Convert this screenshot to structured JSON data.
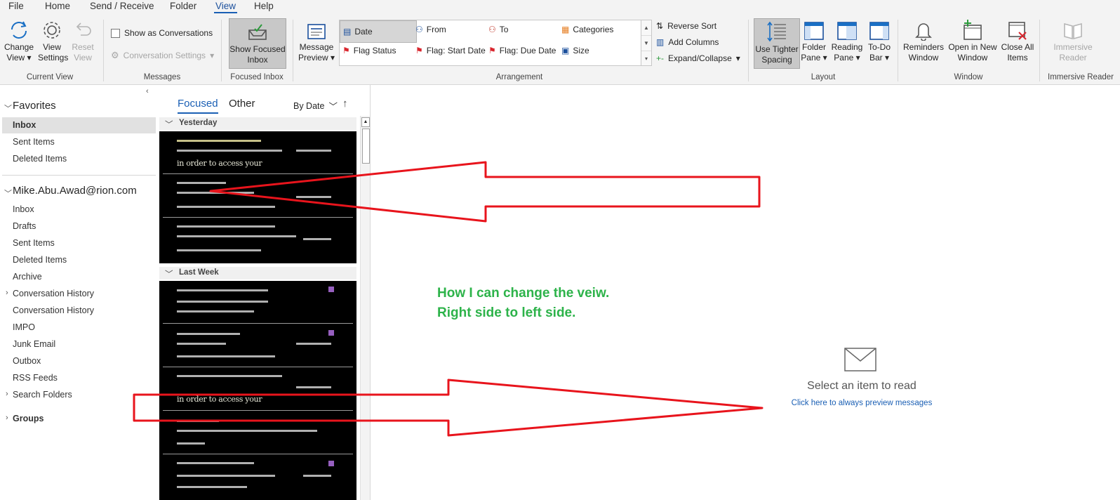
{
  "menu": {
    "tabs": [
      "File",
      "Home",
      "Send / Receive",
      "Folder",
      "View",
      "Help"
    ],
    "active_tab": "View"
  },
  "ribbon": {
    "current_view": {
      "change_view": "Change View",
      "view_settings": "View Settings",
      "reset_view": "Reset View",
      "group_label": "Current View"
    },
    "messages": {
      "show_as_conversations": "Show as Conversations",
      "conversation_settings": "Conversation Settings",
      "group_label": "Messages"
    },
    "focused_inbox": {
      "show_focused_inbox": "Show Focused Inbox",
      "group_label": "Focused Inbox"
    },
    "arrangement": {
      "message_preview": "Message Preview",
      "options": [
        "Date",
        "From",
        "To",
        "Categories",
        "Flag Status",
        "Flag: Start Date",
        "Flag: Due Date",
        "Size"
      ],
      "selected": "Date",
      "reverse_sort": "Reverse Sort",
      "add_columns": "Add Columns",
      "expand_collapse": "Expand/Collapse",
      "group_label": "Arrangement"
    },
    "layout": {
      "use_tighter_spacing": "Use Tighter Spacing",
      "folder_pane": "Folder Pane",
      "reading_pane": "Reading Pane",
      "todo_bar": "To-Do Bar",
      "group_label": "Layout"
    },
    "window": {
      "reminders_window": "Reminders Window",
      "open_in_new_window": "Open in New Window",
      "close_all_items": "Close All Items",
      "group_label": "Window"
    },
    "immersive_reader": {
      "immersive_reader": "Immersive Reader",
      "group_label": "Immersive Reader"
    }
  },
  "folders": {
    "favorites_header": "Favorites",
    "favorites": [
      "Inbox",
      "Sent Items",
      "Deleted Items"
    ],
    "selected": "Inbox",
    "account": "Mike.Abu.Awad@rion.com",
    "account_folders": [
      "Inbox",
      "Drafts",
      "Sent Items",
      "Deleted Items",
      "Archive",
      "Conversation History",
      "Conversation History",
      "IMPO",
      "Junk Email",
      "Outbox",
      "RSS Feeds",
      "Search Folders"
    ],
    "groups": "Groups"
  },
  "message_list": {
    "tab_focused": "Focused",
    "tab_other": "Other",
    "sort_by": "By Date",
    "group_yesterday": "Yesterday",
    "group_last_week": "Last Week",
    "obscured_line": "in order to access your",
    "obscured_line_2": "in order to access your"
  },
  "reading_pane": {
    "select_item": "Select an item to read",
    "preview_link": "Click here to always preview messages"
  },
  "annotation": {
    "line1": "How I can change the veiw.",
    "line2": "Right side to left side."
  },
  "colors": {
    "accent": "#1a5fb4",
    "annotation_green": "#2db34a",
    "arrow_red": "#e8141c"
  }
}
